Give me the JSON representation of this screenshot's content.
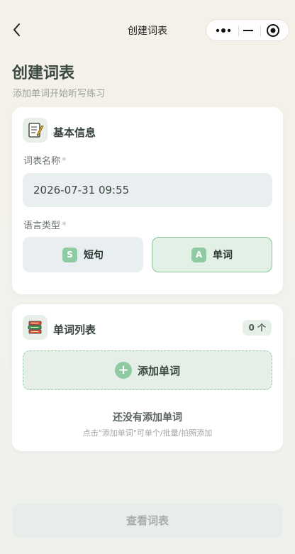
{
  "nav": {
    "title": "创建词表"
  },
  "header": {
    "title": "创建词表",
    "subtitle": "添加单词开始听写练习"
  },
  "basic_info": {
    "title": "基本信息",
    "name_label": "词表名称",
    "name_value": "2026-07-31 09:55",
    "required_mark": "*",
    "lang_label": "语言类型",
    "options": [
      {
        "letter": "S",
        "label": "短句",
        "selected": false
      },
      {
        "letter": "A",
        "label": "单词",
        "selected": true
      }
    ]
  },
  "word_list": {
    "title": "单词列表",
    "count": "0 个",
    "add_label": "添加单词",
    "add_symbol": "+",
    "empty_title": "还没有添加单词",
    "empty_hint": "点击\"添加单词\"可单个/批量/拍照添加"
  },
  "footer": {
    "view_label": "查看词表"
  },
  "colors": {
    "accent": "#8fcaa3",
    "selected_border": "#8ac39b"
  },
  "icons": [
    "back-icon",
    "more-icon",
    "minimize-icon",
    "close-target-icon",
    "memo-icon",
    "books-icon",
    "plus-icon"
  ]
}
